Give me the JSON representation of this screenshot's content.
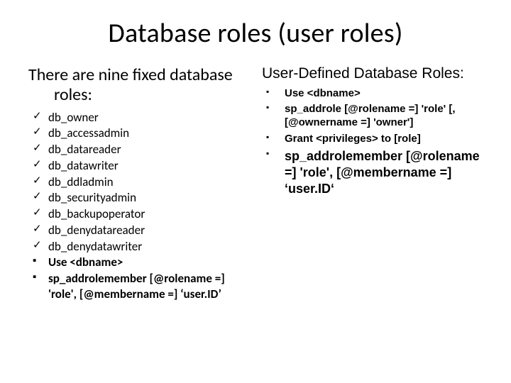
{
  "title": "Database roles (user roles)",
  "left": {
    "heading_l1": "There are nine fixed database",
    "heading_l2": "roles:",
    "items": [
      {
        "marker": "✓",
        "text": "db_owner"
      },
      {
        "marker": "✓",
        "text": "db_accessadmin"
      },
      {
        "marker": "✓",
        "text": "db_datareader"
      },
      {
        "marker": "✓",
        "text": "db_datawriter"
      },
      {
        "marker": "✓",
        "text": "db_ddladmin"
      },
      {
        "marker": "✓",
        "text": "db_securityadmin"
      },
      {
        "marker": "✓",
        "text": "db_backupoperator"
      },
      {
        "marker": "✓",
        "text": "db_denydatareader"
      },
      {
        "marker": "✓",
        "text": "db_denydatawriter"
      },
      {
        "marker": "▪",
        "text": "Use <dbname>",
        "bold": true
      },
      {
        "marker": "▪",
        "text": "sp_addrolemember [@rolename =] 'role', [@membername =] ‘user.ID’",
        "bold": true
      }
    ]
  },
  "right": {
    "heading": "User-Defined Database Roles:",
    "items": [
      {
        "marker": "▪",
        "text": "Use <dbname>",
        "bold": true
      },
      {
        "marker": "▪",
        "text": "sp_addrole [@rolename =] 'role' [, [@ownername =] 'owner']",
        "bold": true
      },
      {
        "marker": "▪",
        "text": "Grant <privileges> to [role]",
        "bold": true
      },
      {
        "marker": "▪",
        "text": "sp_addrolemember [@rolename =] 'role', [@membername =] ‘user.ID‘",
        "bold": true,
        "big": true
      }
    ]
  }
}
